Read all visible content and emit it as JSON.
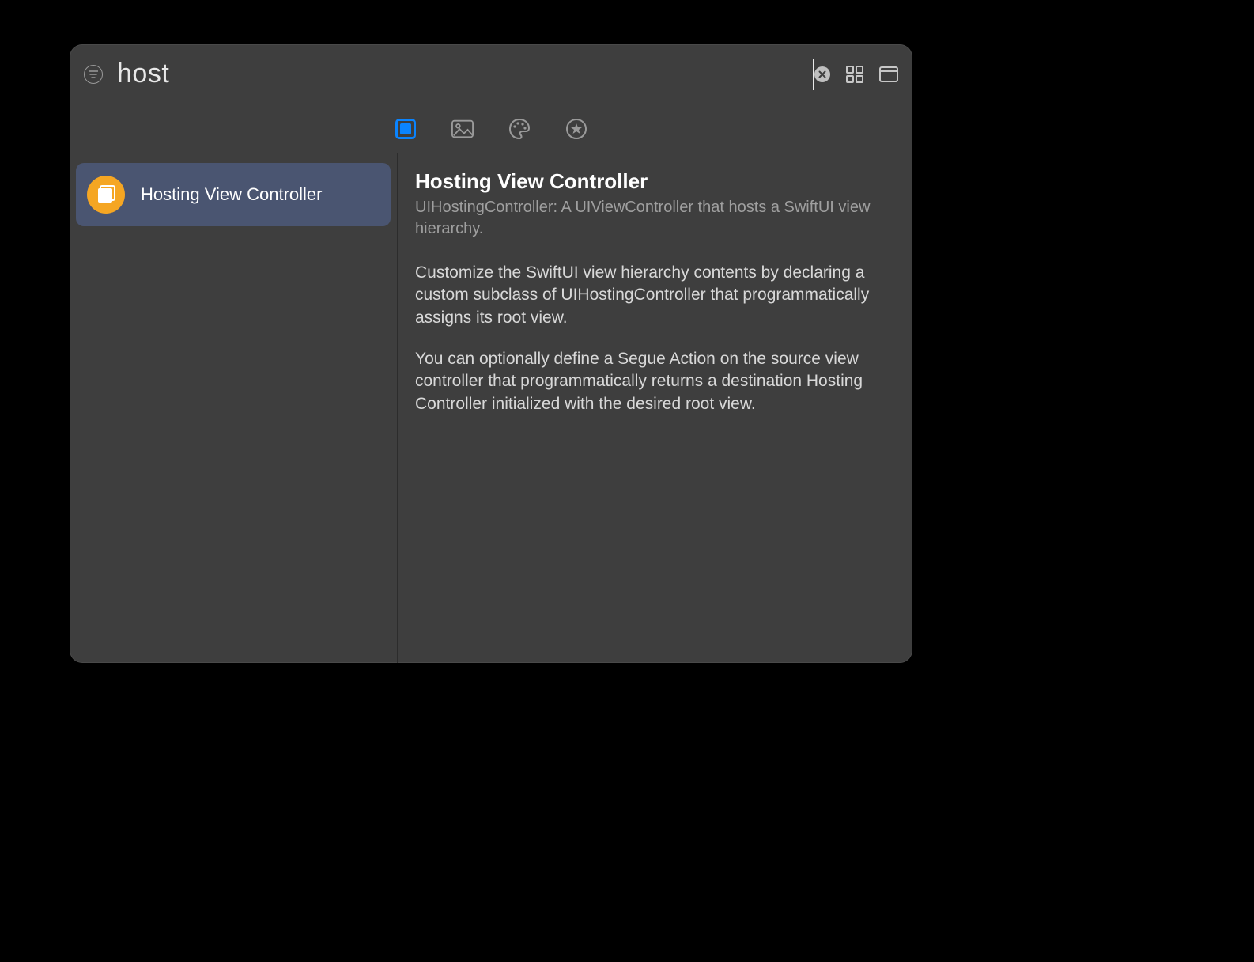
{
  "search": {
    "value": "host"
  },
  "tabs": {
    "active_index": 0,
    "names": [
      "objects-tab",
      "media-tab",
      "color-tab",
      "snippets-tab"
    ]
  },
  "results": [
    {
      "label": "Hosting View Controller",
      "icon": "hosting-controller-icon"
    }
  ],
  "detail": {
    "title": "Hosting View Controller",
    "subtitle": "UIHostingController: A UIViewController that hosts a SwiftUI view hierarchy.",
    "paragraphs": [
      "Customize the SwiftUI view hierarchy contents by declaring a custom subclass of UIHostingController that programmatically assigns its root view.",
      "You can optionally define a Segue Action on the source view controller that programmatically returns a destination Hosting Controller initialized with the desired root view."
    ]
  }
}
